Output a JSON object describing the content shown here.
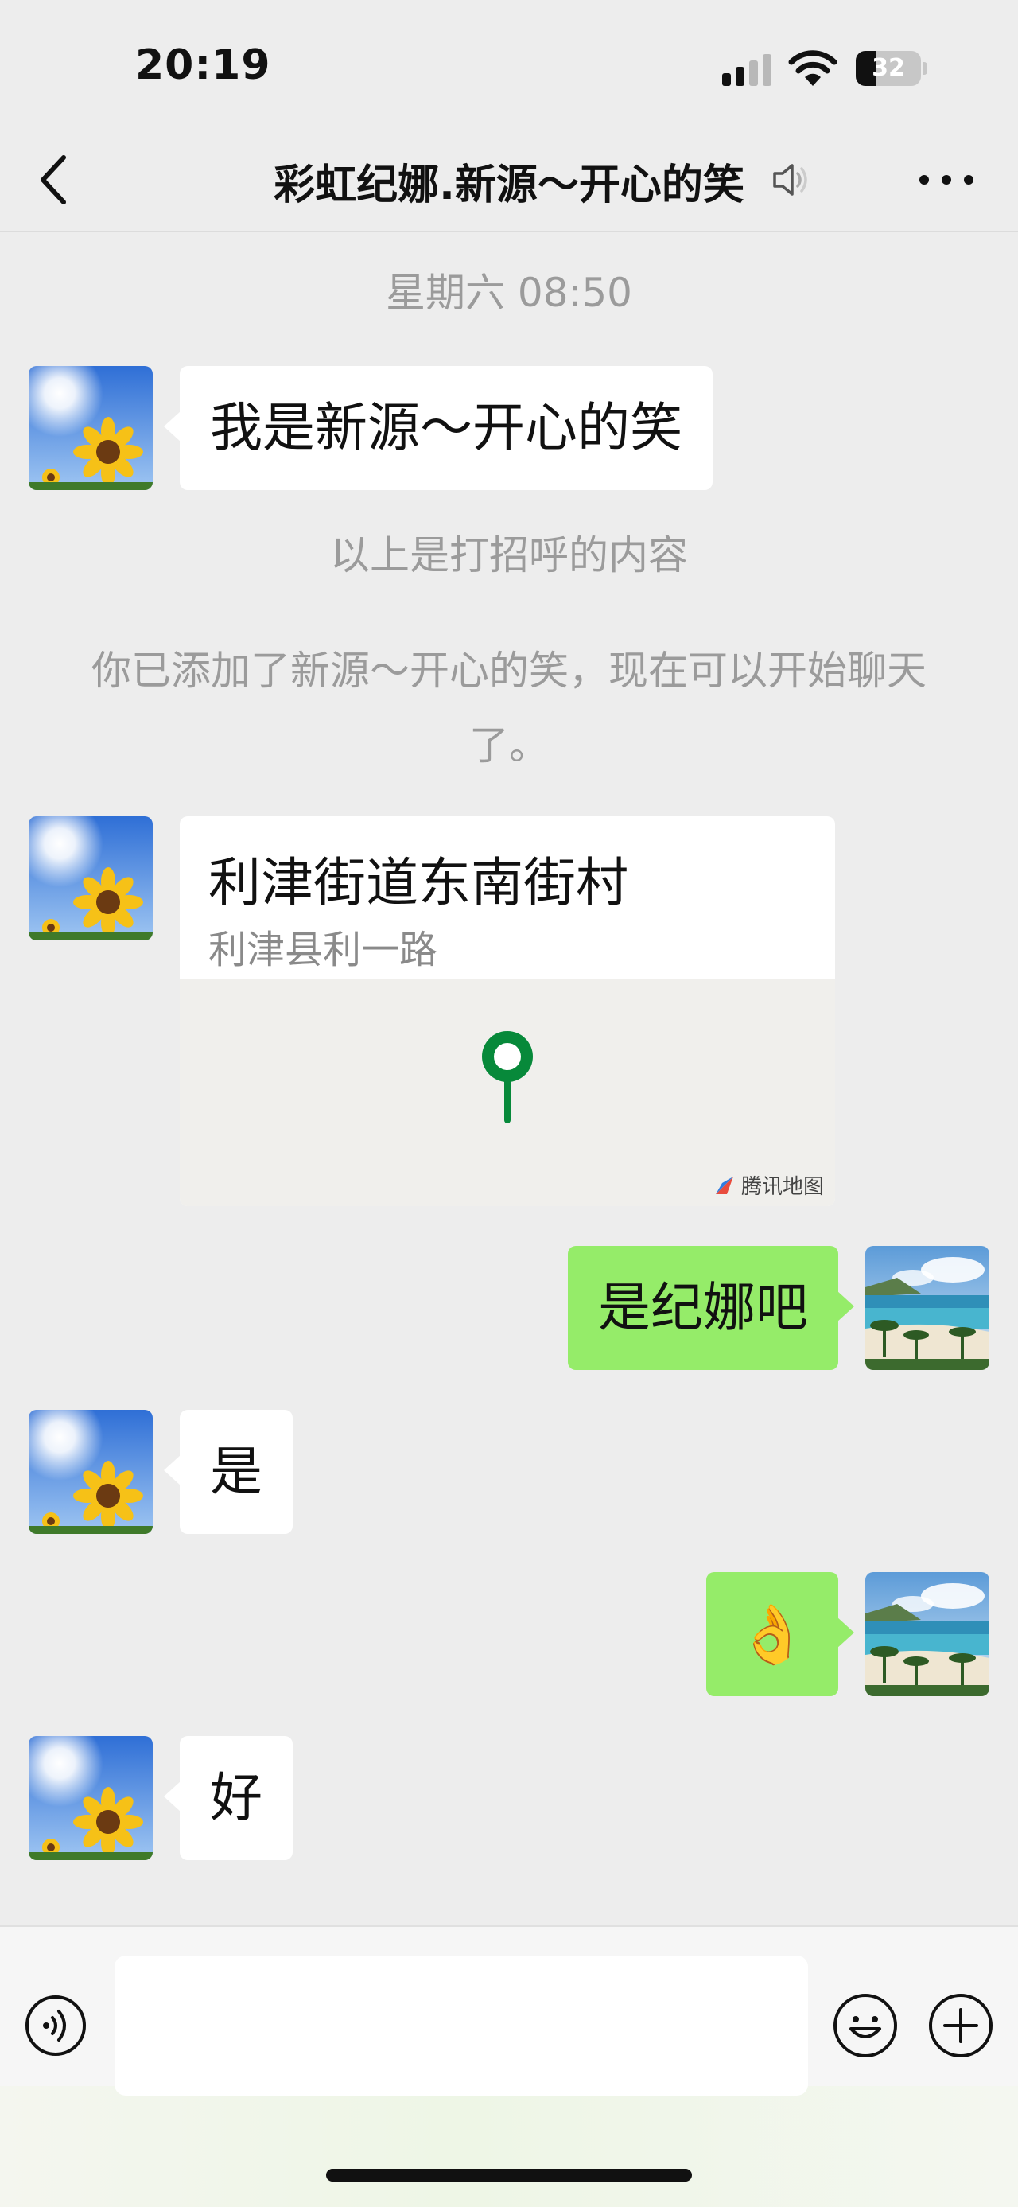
{
  "status_bar": {
    "time": "20:19",
    "battery_text": "32",
    "battery_level_percent": 32
  },
  "header": {
    "title": "彩虹纪娜.新源～开心的笑",
    "back_icon": "chevron-left-icon",
    "mute_icon": "speaker-muted-icon",
    "more_icon": "more-dots-icon"
  },
  "chat": {
    "timestamp": "星期六 08:50",
    "greeting_message": "我是新源～开心的笑",
    "greeting_note": "以上是打招呼的内容",
    "added_note": "你已添加了新源～开心的笑，现在可以开始聊天了。",
    "location": {
      "name": "利津街道东南街村",
      "address": "利津县利一路",
      "map_brand": "腾讯地图"
    },
    "messages": [
      {
        "side": "out",
        "text": "是纪娜吧"
      },
      {
        "side": "in",
        "text": "是"
      },
      {
        "side": "out",
        "text": "👌"
      },
      {
        "side": "in",
        "text": "好"
      }
    ]
  },
  "input_bar": {
    "text_value": "",
    "voice_icon": "voice-icon",
    "emoji_icon": "emoji-icon",
    "plus_icon": "plus-icon"
  },
  "colors": {
    "background": "#ededed",
    "outgoing_bubble": "#95ec69",
    "incoming_bubble": "#ffffff",
    "map_pin": "#07893a"
  }
}
